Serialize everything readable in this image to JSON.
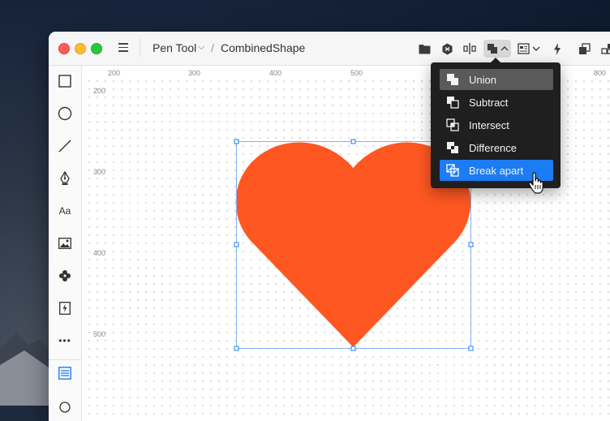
{
  "window": {
    "breadcrumb": {
      "project": "Pen Tool",
      "separator": "/",
      "document": "CombinedShape"
    }
  },
  "toolbar": {
    "icons": [
      "folder-icon",
      "component-icon",
      "align-icon",
      "boolean-ops-icon",
      "layout-icon",
      "flash-icon",
      "duplicate-icon",
      "grid-icon"
    ]
  },
  "tools": {
    "items": [
      "rectangle-icon",
      "ellipse-icon",
      "line-icon",
      "pen-icon",
      "text-tool",
      "image-icon",
      "symbol-icon",
      "flash-icon",
      "more-icon",
      "inspector-icon"
    ],
    "text_label": "Aa",
    "more_label": "•••"
  },
  "rulers": {
    "top": [
      "200",
      "300",
      "400",
      "500",
      "800"
    ],
    "left": [
      "200",
      "300",
      "400",
      "500"
    ]
  },
  "boolean_menu": {
    "items": [
      {
        "label": "Union",
        "state": "hover"
      },
      {
        "label": "Subtract",
        "state": "normal"
      },
      {
        "label": "Intersect",
        "state": "normal"
      },
      {
        "label": "Difference",
        "state": "normal"
      },
      {
        "label": "Break apart",
        "state": "selected"
      }
    ]
  },
  "colors": {
    "heart": "#fe5722",
    "selection": "#1c7cf4",
    "menu_bg": "#1f1f1f",
    "selection_outline": "#7fb2ee"
  }
}
